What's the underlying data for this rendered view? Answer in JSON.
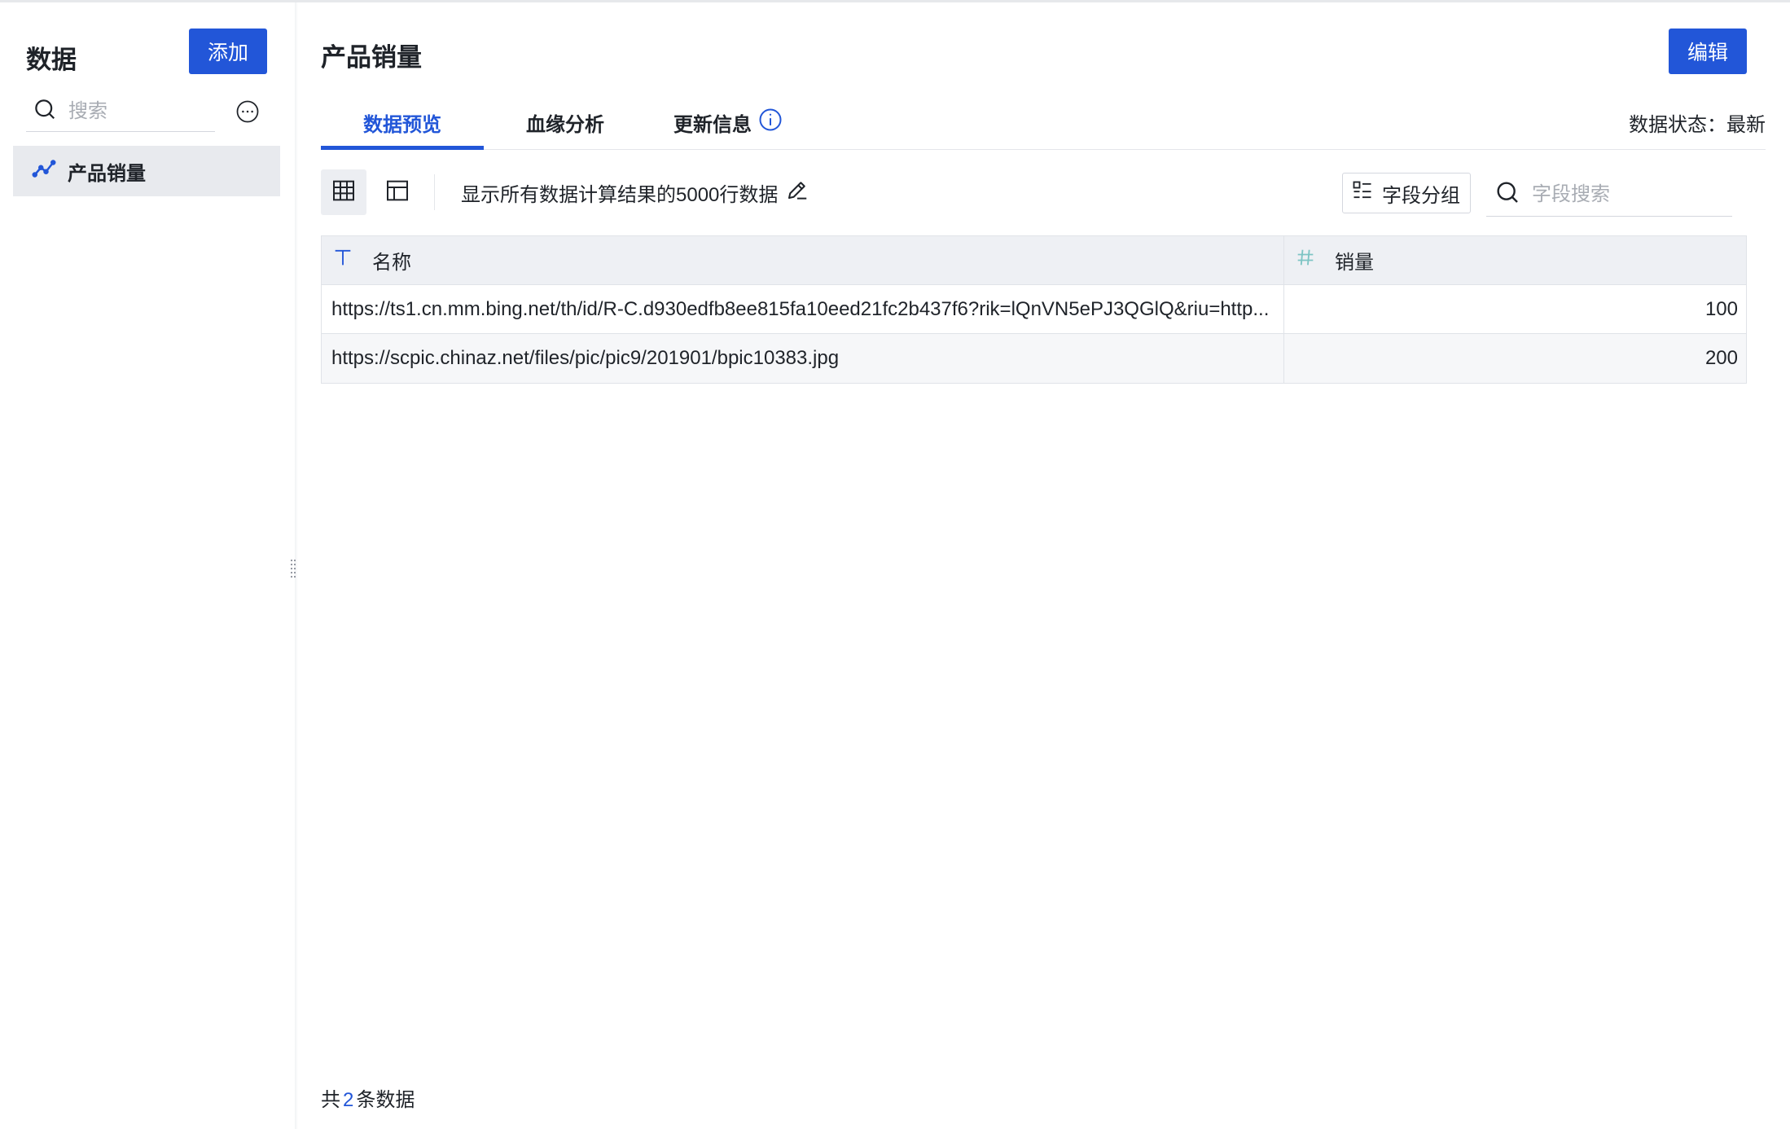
{
  "sidebar": {
    "title": "数据",
    "add_label": "添加",
    "search_placeholder": "搜索",
    "items": [
      {
        "label": "产品销量",
        "icon": "line-chart-icon"
      }
    ]
  },
  "main": {
    "title": "产品销量",
    "edit_label": "编辑",
    "tabs": [
      {
        "label": "数据预览",
        "active": true
      },
      {
        "label": "血缘分析",
        "active": false
      },
      {
        "label": "更新信息",
        "active": false,
        "icon": "info-icon"
      }
    ],
    "status_text": "数据状态：最新",
    "toolbar": {
      "row_info": "显示所有数据计算结果的5000行数据",
      "group_label": "字段分组",
      "field_search_placeholder": "字段搜索"
    },
    "table": {
      "columns": [
        {
          "label": "名称",
          "type_icon": "text-type-icon"
        },
        {
          "label": "销量",
          "type_icon": "number-type-icon"
        }
      ],
      "rows": [
        {
          "name": "https://ts1.cn.mm.bing.net/th/id/R-C.d930edfb8ee815fa10eed21fc2b437f6?rik=lQnVN5ePJ3QGlQ&riu=http...",
          "sales": "100"
        },
        {
          "name": "https://scpic.chinaz.net/files/pic/pic9/201901/bpic10383.jpg",
          "sales": "200"
        }
      ]
    },
    "footer": {
      "prefix": "共",
      "count": "2",
      "suffix": "条数据"
    }
  },
  "colors": {
    "accent": "#2256d8",
    "sidebar_selected": "#e8eaee",
    "table_header": "#eef0f4",
    "number_icon": "#7dc4c4"
  }
}
